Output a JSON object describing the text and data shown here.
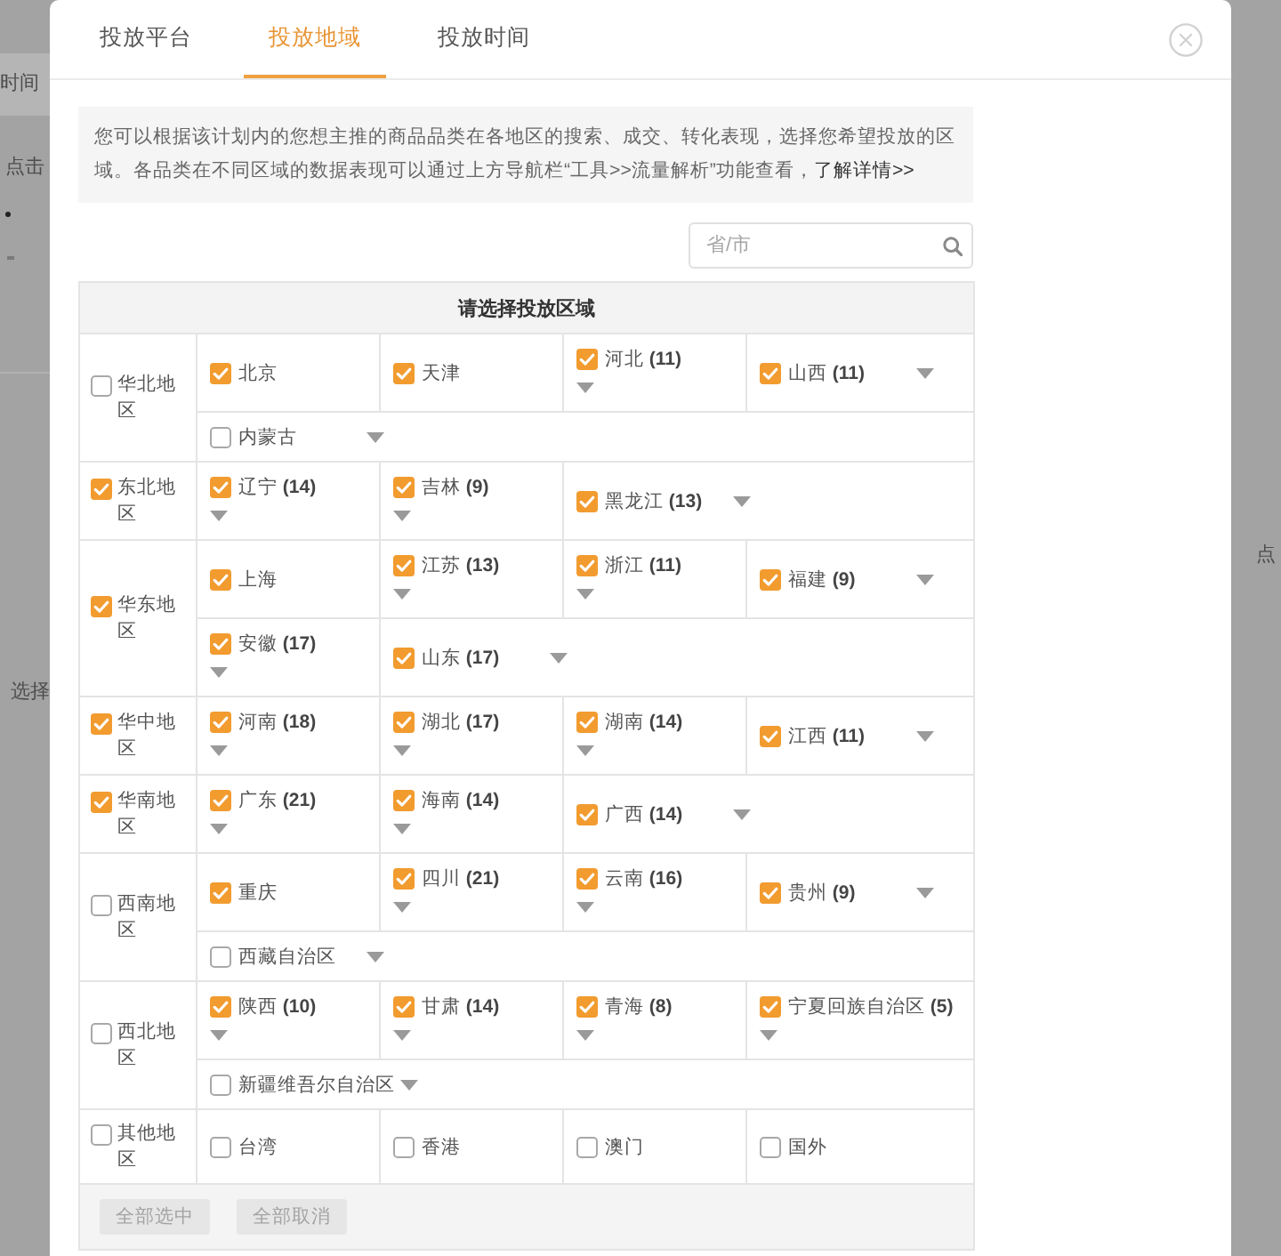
{
  "backdrop": {
    "left": [
      "时间",
      "点击",
      "选择"
    ],
    "right": [
      "点"
    ]
  },
  "tabs": [
    {
      "label": "投放平台",
      "selected": false
    },
    {
      "label": "投放地域",
      "selected": true
    },
    {
      "label": "投放时间",
      "selected": false
    }
  ],
  "notice": {
    "text": "您可以根据该计划内的您想主推的商品品类在各地区的搜索、成交、转化表现，选择您希望投放的区域。各品类在不同区域的数据表现可以通过上方导航栏“工具>>流量解析”功能查看，",
    "link": "了解详情>>"
  },
  "search": {
    "placeholder": "省/市"
  },
  "region_table": {
    "title": "请选择投放区域",
    "regions": [
      {
        "name": "华北地区",
        "checked": false,
        "provinces": [
          {
            "label": "北京",
            "checked": true,
            "expandable": false
          },
          {
            "label": "天津",
            "checked": true,
            "expandable": false
          },
          {
            "label": "河北 **(11)**",
            "checked": true,
            "expandable": true
          },
          {
            "label": "山西 **(11)**",
            "checked": true,
            "expandable": true
          },
          {
            "label": "内蒙古",
            "checked": false,
            "expandable": true
          }
        ]
      },
      {
        "name": "东北地区",
        "checked": true,
        "provinces": [
          {
            "label": "辽宁 **(14)**",
            "checked": true,
            "expandable": true
          },
          {
            "label": "吉林 **(9)**",
            "checked": true,
            "expandable": true
          },
          {
            "label": "黑龙江 **(13)**",
            "checked": true,
            "expandable": true
          }
        ]
      },
      {
        "name": "华东地区",
        "checked": true,
        "provinces": [
          {
            "label": "上海",
            "checked": true,
            "expandable": false
          },
          {
            "label": "江苏 **(13)**",
            "checked": true,
            "expandable": true
          },
          {
            "label": "浙江 **(11)**",
            "checked": true,
            "expandable": true
          },
          {
            "label": "福建 **(9)**",
            "checked": true,
            "expandable": true
          },
          {
            "label": "安徽 **(17)**",
            "checked": true,
            "expandable": true
          },
          {
            "label": "山东 **(17)**",
            "checked": true,
            "expandable": true
          }
        ]
      },
      {
        "name": "华中地区",
        "checked": true,
        "provinces": [
          {
            "label": "河南 **(18)**",
            "checked": true,
            "expandable": true
          },
          {
            "label": "湖北 **(17)**",
            "checked": true,
            "expandable": true
          },
          {
            "label": "湖南 **(14)**",
            "checked": true,
            "expandable": true
          },
          {
            "label": "江西 **(11)**",
            "checked": true,
            "expandable": true
          }
        ]
      },
      {
        "name": "华南地区",
        "checked": true,
        "provinces": [
          {
            "label": "广东 **(21)**",
            "checked": true,
            "expandable": true
          },
          {
            "label": "海南 **(14)**",
            "checked": true,
            "expandable": true
          },
          {
            "label": "广西 **(14)**",
            "checked": true,
            "expandable": true
          }
        ]
      },
      {
        "name": "西南地区",
        "checked": false,
        "provinces": [
          {
            "label": "重庆",
            "checked": true,
            "expandable": false
          },
          {
            "label": "四川 **(21)**",
            "checked": true,
            "expandable": true
          },
          {
            "label": "云南 **(16)**",
            "checked": true,
            "expandable": true
          },
          {
            "label": "贵州 **(9)**",
            "checked": true,
            "expandable": true
          },
          {
            "label": "西藏自治区",
            "checked": false,
            "expandable": true
          }
        ]
      },
      {
        "name": "西北地区",
        "checked": false,
        "provinces": [
          {
            "label": "陕西 **(10)**",
            "checked": true,
            "expandable": true
          },
          {
            "label": "甘肃 **(14)**",
            "checked": true,
            "expandable": true
          },
          {
            "label": "青海 **(8)**",
            "checked": true,
            "expandable": true
          },
          {
            "label": "宁夏回族自治区 **(5)**",
            "checked": true,
            "expandable": true
          },
          {
            "label": "新疆维吾尔自治区",
            "checked": false,
            "expandable": true
          }
        ]
      },
      {
        "name": "其他地区",
        "checked": false,
        "provinces": [
          {
            "label": "台湾",
            "checked": false,
            "expandable": false
          },
          {
            "label": "香港",
            "checked": false,
            "expandable": false
          },
          {
            "label": "澳门",
            "checked": false,
            "expandable": false
          },
          {
            "label": "国外",
            "checked": false,
            "expandable": false
          }
        ]
      }
    ]
  },
  "buttons": [
    "全部选中",
    "全部取消"
  ]
}
